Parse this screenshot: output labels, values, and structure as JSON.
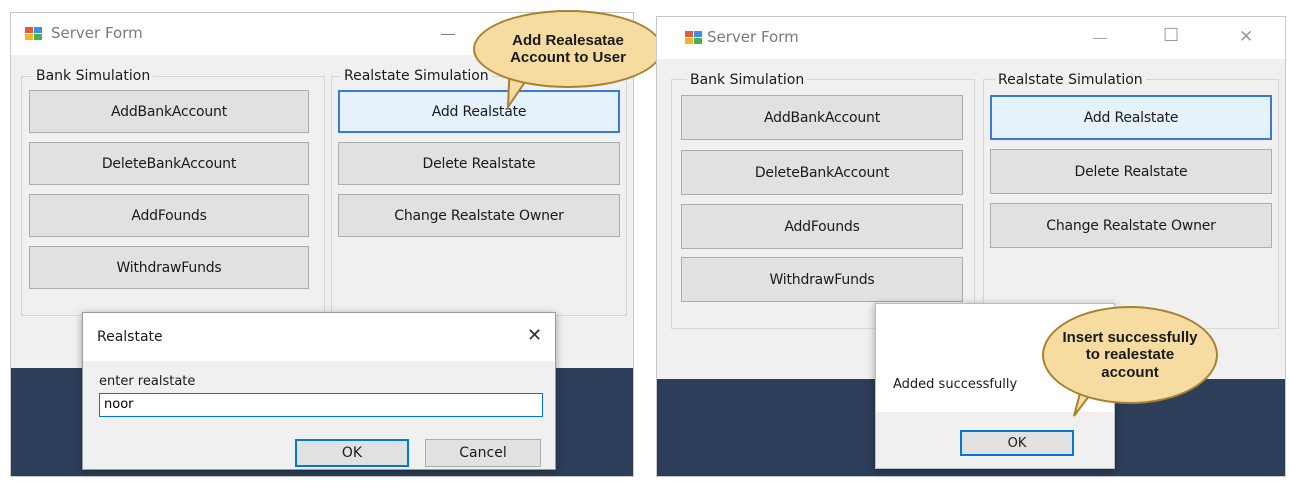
{
  "left_window": {
    "title": "Server Form",
    "bank_group_label": "Bank Simulation",
    "realstate_group_label": "Realstate Simulation",
    "bank_buttons": [
      "AddBankAccount",
      "DeleteBankAccount",
      "AddFounds",
      "WithdrawFunds"
    ],
    "realstate_buttons": [
      "Add Realstate",
      "Delete Realstate",
      "Change Realstate Owner"
    ],
    "minimize_glyph": "—"
  },
  "input_dialog": {
    "title": "Realstate",
    "close_glyph": "✕",
    "prompt": "enter realstate",
    "input_value": "noor",
    "ok_label": "OK",
    "cancel_label": "Cancel"
  },
  "callout_left": {
    "text": "Add Realesatae\nAccount to User"
  },
  "right_window": {
    "title": "Server Form",
    "bank_group_label": "Bank Simulation",
    "realstate_group_label": "Realstate Simulation",
    "bank_buttons": [
      "AddBankAccount",
      "DeleteBankAccount",
      "AddFounds",
      "WithdrawFunds"
    ],
    "realstate_buttons": [
      "Add Realstate",
      "Delete Realstate",
      "Change Realstate Owner"
    ],
    "minimize_glyph": "—",
    "maximize_glyph": "☐",
    "close_glyph": "✕"
  },
  "message_box": {
    "message": "Added successfully",
    "ok_label": "OK"
  },
  "callout_right": {
    "text": "Insert successfully\nto realestate\naccount"
  },
  "colors": {
    "window_bg": "#f0f0f0",
    "button_bg": "#e1e1e1",
    "focus_blue": "#3a7bd5",
    "taskbar": "#2d3e5a",
    "callout_fill": "#f6dca0",
    "callout_border": "#a7822e"
  }
}
